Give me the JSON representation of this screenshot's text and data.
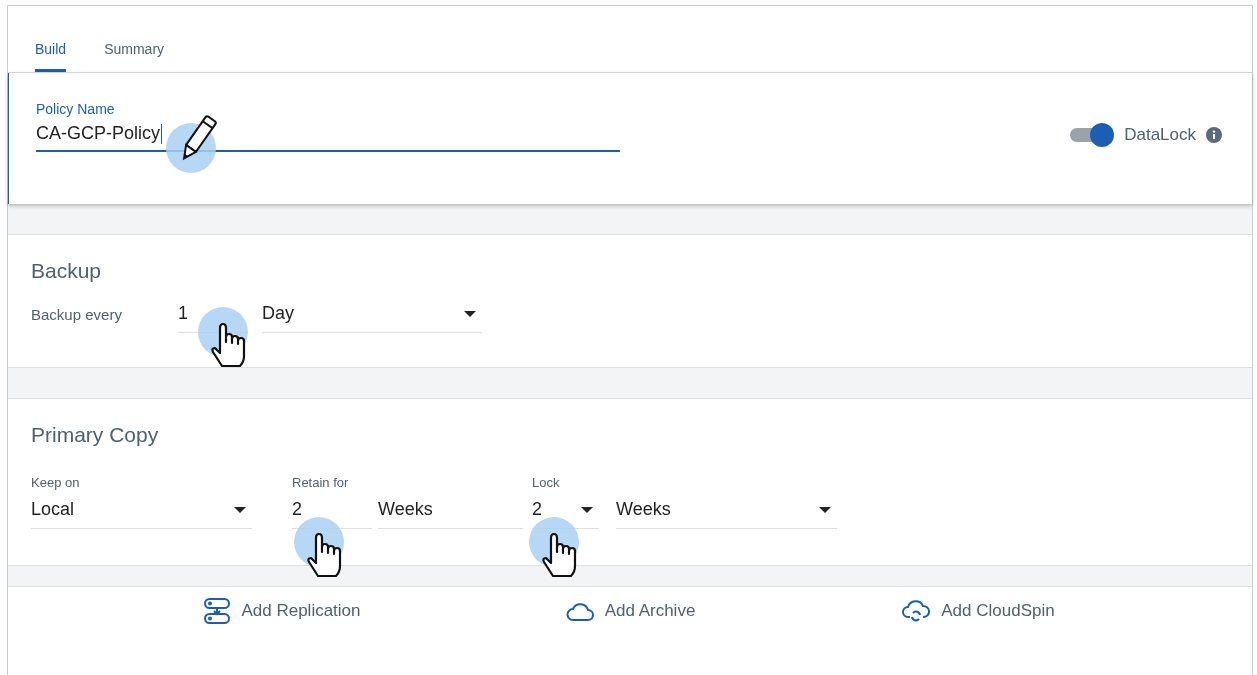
{
  "tabs": [
    {
      "label": "Build",
      "selected": true
    },
    {
      "label": "Summary",
      "selected": false
    }
  ],
  "policy_name": {
    "label": "Policy Name",
    "value": "CA-GCP-Policy"
  },
  "datalock": {
    "label": "DataLock",
    "on": true
  },
  "backup": {
    "title": "Backup",
    "label": "Backup every",
    "fields": [
      {
        "kind": "input",
        "value": "1"
      },
      {
        "kind": "select",
        "value": "Day"
      }
    ]
  },
  "primary_copy": {
    "title": "Primary Copy",
    "fields": [
      {
        "kind": "select",
        "label": "Keep on",
        "value": "Local"
      },
      {
        "kind": "input",
        "label": "Retain for",
        "value": "2"
      },
      {
        "kind": "input",
        "value": "Weeks"
      },
      {
        "kind": "select",
        "label": "Lock",
        "value": "2"
      },
      {
        "kind": "select",
        "value": "Weeks"
      }
    ]
  },
  "actions": [
    {
      "kind": "replication",
      "label": "Add Replication"
    },
    {
      "kind": "archive",
      "label": "Add Archive"
    },
    {
      "kind": "cloudspin",
      "label": "Add CloudSpin"
    }
  ]
}
